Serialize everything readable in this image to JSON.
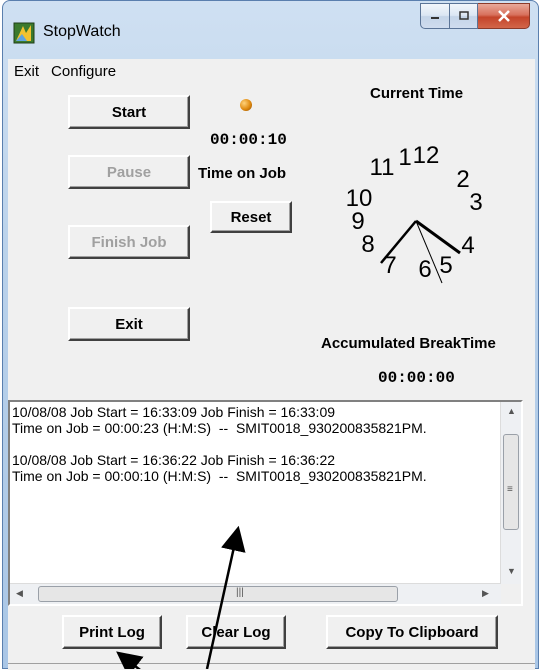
{
  "window": {
    "title": "StopWatch"
  },
  "menu": [
    "Exit",
    "Configure"
  ],
  "buttons": {
    "start": "Start",
    "pause": "Pause",
    "finish_job": "Finish Job",
    "exit": "Exit",
    "reset": "Reset",
    "print_log": "Print Log",
    "clear_log": "Clear Log",
    "copy_to_clipboard": "Copy To Clipboard"
  },
  "labels": {
    "current_time": "Current Time",
    "job_time_value": "00:00:10",
    "time_on_job": "Time on Job",
    "accumulated_break_time": "Accumulated BreakTime",
    "break_time_value": "00:00:00"
  },
  "clock": {
    "numbers": [
      "12",
      "1",
      "2",
      "3",
      "4",
      "5",
      "6",
      "7",
      "8",
      "9",
      "10",
      "11"
    ]
  },
  "log": {
    "lines": [
      "10/08/08 Job Start = 16:33:09 Job Finish = 16:33:09",
      "Time on Job = 00:00:23 (H:M:S)  --  SMIT0018_930200835821PM.",
      "",
      "10/08/08 Job Start = 16:36:22 Job Finish = 16:36:22",
      "Time on Job = 00:00:10 (H:M:S)  --  SMIT0018_930200835821PM."
    ]
  },
  "icons": {
    "app": "stopwatch-app-icon",
    "minimize": "minimize-icon",
    "maximize": "maximize-icon",
    "close": "close-icon"
  }
}
